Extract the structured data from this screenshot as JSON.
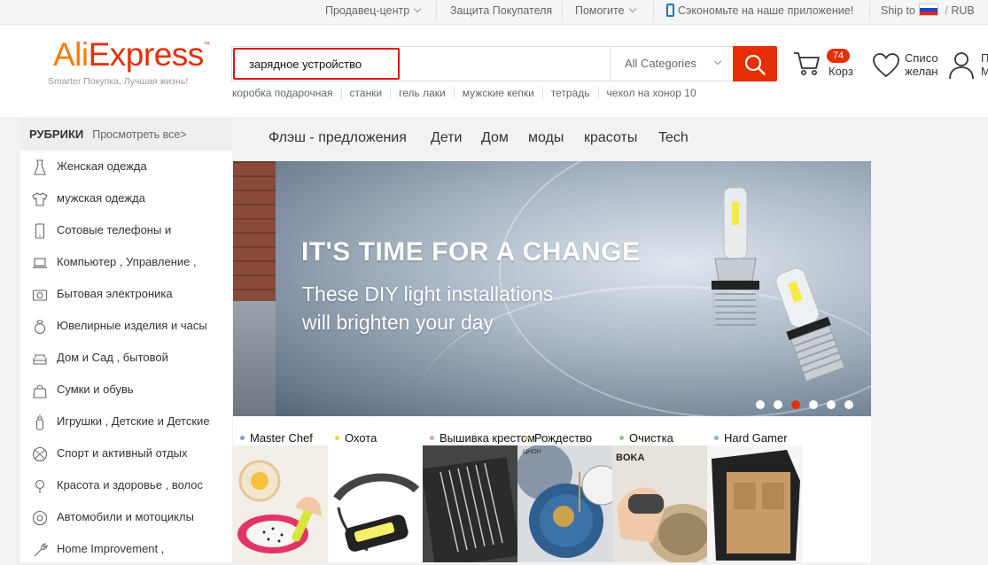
{
  "topbar": {
    "seller_center": "Продавец-центр",
    "buyer_protection": "Защита Покупателя",
    "help": "Помогите",
    "app_promo": "Сэкономьте на наше приложение!",
    "ship_to": "Ship to",
    "currency": "RUB"
  },
  "header": {
    "logo_ali": "Ali",
    "logo_express": "Express",
    "logo_tm": "™",
    "tagline": "Smarter Покупка, Лучшая жизнь!",
    "search_value": "зарядное устройство",
    "category_select": "All Categories",
    "hotwords": [
      "коробка подарочная",
      "станки",
      "гель лаки",
      "мужские кепки",
      "тетрадь",
      "чехол на хонор 10"
    ],
    "cart_count": "74",
    "cart_label": "Корз",
    "wishlist_line1": "Списо",
    "wishlist_line2": "желан",
    "account_line1": "П",
    "account_line2": "М"
  },
  "sidebar": {
    "title": "РУБРИКИ",
    "view_all": "Просмотреть все>",
    "items": [
      {
        "label": "Женская одежда",
        "icon": "dress-icon"
      },
      {
        "label": "мужская одежда",
        "icon": "shirt-icon"
      },
      {
        "label": "Сотовые телефоны и",
        "icon": "phone-icon"
      },
      {
        "label": "Компьютер , Управление ,",
        "icon": "laptop-icon"
      },
      {
        "label": "Бытовая электроника",
        "icon": "camera-icon"
      },
      {
        "label": "Ювелирные изделия и часы",
        "icon": "ring-icon"
      },
      {
        "label": "Дом и Сад , бытовой",
        "icon": "sofa-icon"
      },
      {
        "label": "Сумки и обувь",
        "icon": "bag-icon"
      },
      {
        "label": "Игрушки , Детские и Детские",
        "icon": "bottle-icon"
      },
      {
        "label": "Спорт и активный отдых",
        "icon": "ball-icon"
      },
      {
        "label": "Красота и здоровье , волос",
        "icon": "pin-icon"
      },
      {
        "label": "Автомобили и мотоциклы",
        "icon": "wheel-icon"
      },
      {
        "label": "Home Improvement ,",
        "icon": "tools-icon"
      }
    ]
  },
  "nav": {
    "tabs": [
      "Флэш - предложения",
      "Дети",
      "Дом",
      "моды",
      "красоты",
      "Tech"
    ]
  },
  "banner": {
    "title": "IT'S TIME FOR A CHANGE",
    "subtitle_line1": "These DIY light installations",
    "subtitle_line2": "will brighten your day",
    "slide_count": 6,
    "active_slide": 3
  },
  "promos": [
    {
      "label": "Master Chef",
      "dot": "#7aa0c8"
    },
    {
      "label": "Охота",
      "dot": "#f2d24a"
    },
    {
      "label": "Вышивка крестом",
      "dot": "#e8a0a0"
    },
    {
      "label": "Рождество",
      "dot": "#e8c06a"
    },
    {
      "label": "Очистка",
      "dot": "#8cc98a"
    },
    {
      "label": "Hard Gamer",
      "dot": "#7ab8c8"
    }
  ],
  "promo_image_texts": {
    "cleaning_brand": "BOKA",
    "christmas_sign": "ЦНОН"
  },
  "colors": {
    "brand": "#e62e04",
    "logo_orange": "#ff7a00",
    "search_highlight": "#e0141d"
  }
}
